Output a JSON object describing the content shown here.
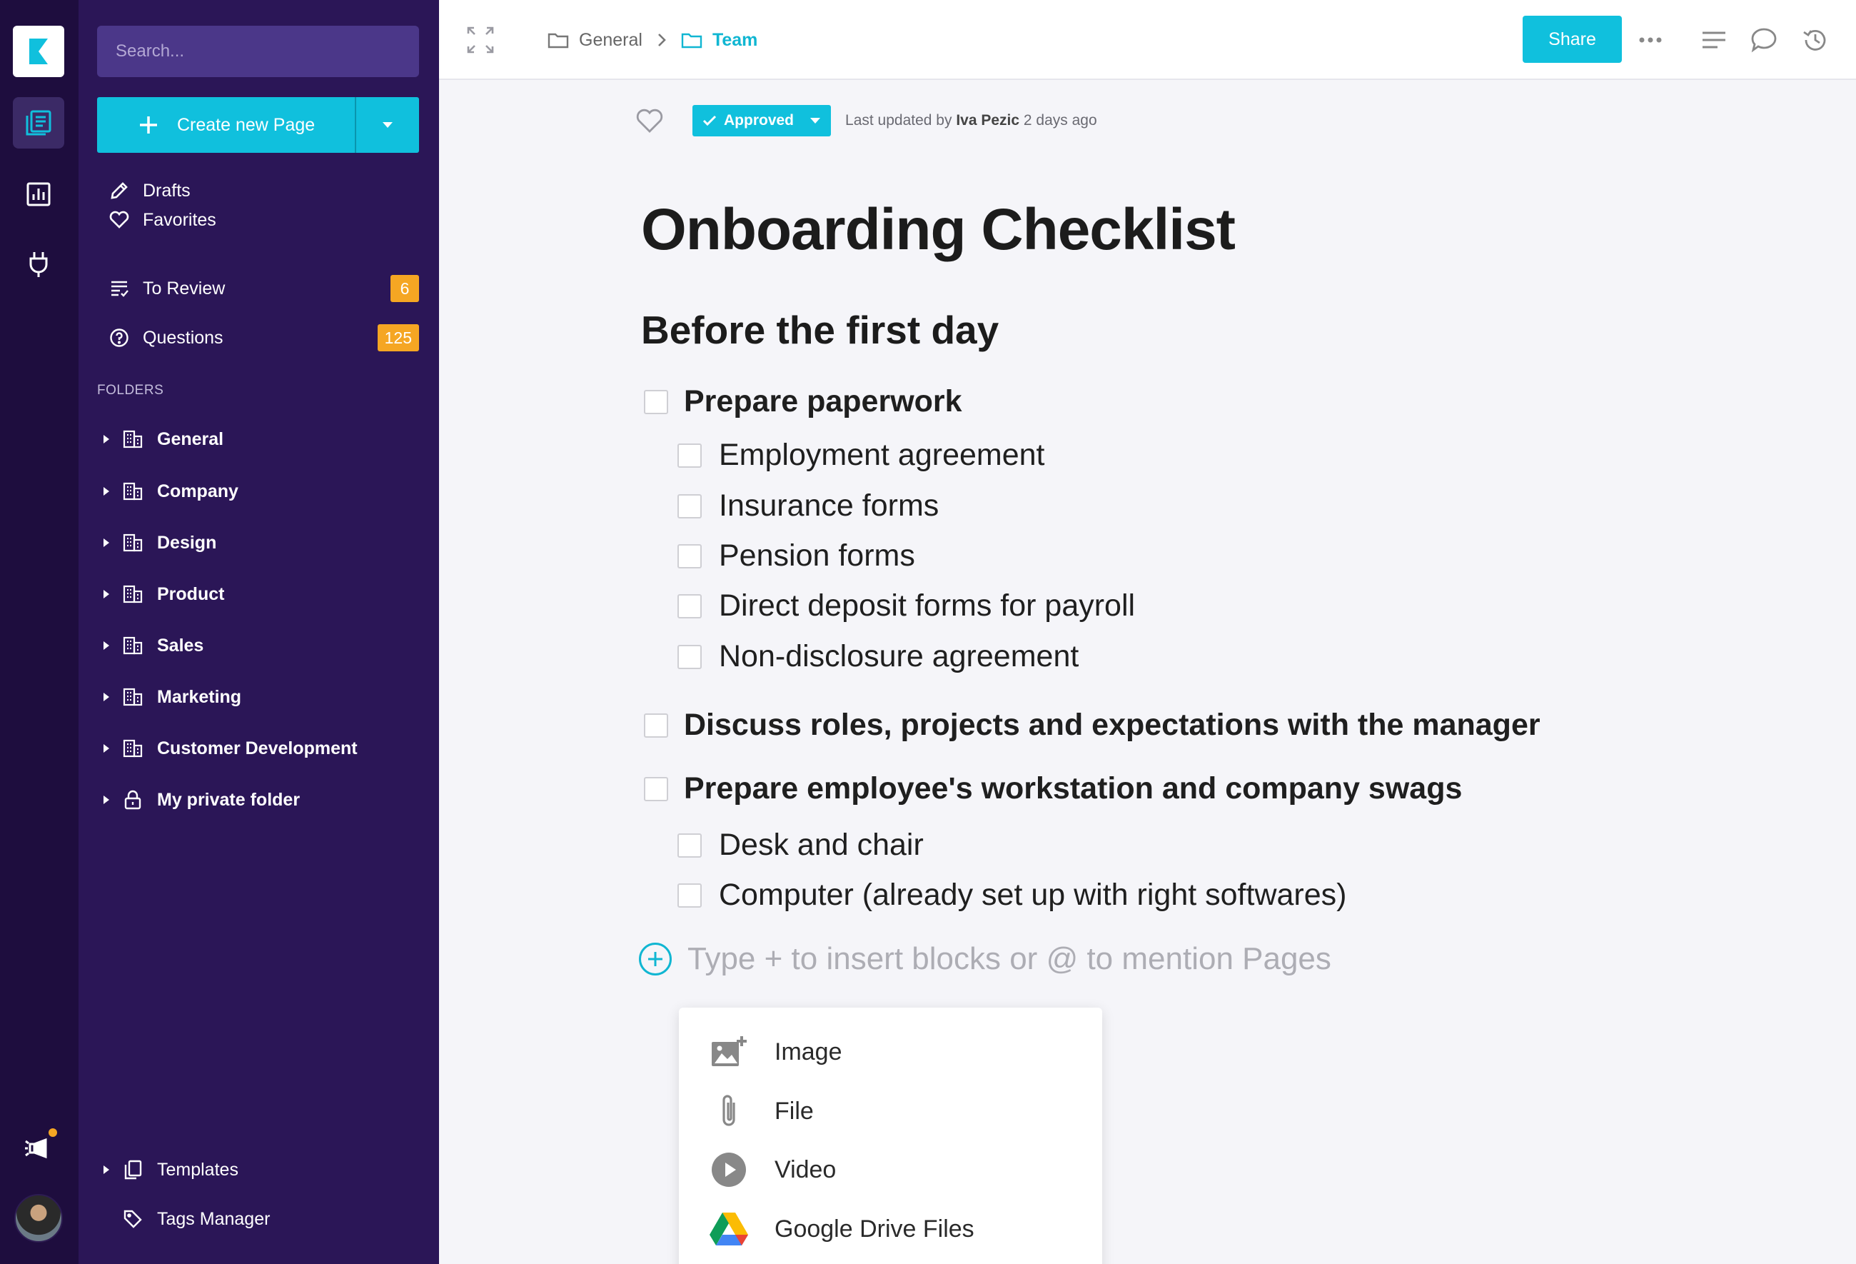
{
  "rail": {
    "icons": [
      "logo-icon",
      "pages-icon",
      "analytics-icon",
      "integrations-plug-icon",
      "announcements-icon"
    ],
    "colors": {
      "background": "#1e0d3e",
      "active": "#3b2a66",
      "notification": "#f5a623"
    }
  },
  "sidebar": {
    "search_placeholder": "Search...",
    "create_label": "Create new Page",
    "nav": [
      {
        "label": "Drafts",
        "icon": "pencil-icon"
      },
      {
        "label": "Favorites",
        "icon": "heart-icon"
      },
      {
        "label": "To Review",
        "icon": "review-list-icon",
        "badge": "6"
      },
      {
        "label": "Questions",
        "icon": "question-icon",
        "badge": "125"
      }
    ],
    "folders_heading": "FOLDERS",
    "folders": [
      {
        "label": "General",
        "icon": "building-icon"
      },
      {
        "label": "Company",
        "icon": "building-icon"
      },
      {
        "label": "Design",
        "icon": "building-icon"
      },
      {
        "label": "Product",
        "icon": "building-icon"
      },
      {
        "label": "Sales",
        "icon": "building-icon"
      },
      {
        "label": "Marketing",
        "icon": "building-icon"
      },
      {
        "label": "Customer Development",
        "icon": "building-icon"
      },
      {
        "label": "My private folder",
        "icon": "lock-icon"
      }
    ],
    "templates_label": "Templates",
    "tags_label": "Tags Manager",
    "colors": {
      "background": "#2b1657",
      "accent": "#10c0dd",
      "badge": "#f5a623"
    }
  },
  "topbar": {
    "breadcrumb": [
      "General",
      "Team"
    ],
    "share_label": "Share"
  },
  "document": {
    "status": "Approved",
    "updated_prefix": "Last updated by",
    "updated_by": "Iva Pezic",
    "updated_when": "2 days ago",
    "title": "Onboarding Checklist",
    "section": "Before the first day",
    "checklist": [
      {
        "text": "Prepare paperwork",
        "level": 1,
        "checked": false
      },
      {
        "text": "Employment agreement",
        "level": 2,
        "checked": false
      },
      {
        "text": "Insurance forms",
        "level": 2,
        "checked": false
      },
      {
        "text": "Pension forms",
        "level": 2,
        "checked": false
      },
      {
        "text": "Direct deposit forms for payroll",
        "level": 2,
        "checked": false
      },
      {
        "text": "Non-disclosure agreement",
        "level": 2,
        "checked": false
      },
      {
        "text": "Discuss roles, projects and expectations with the manager",
        "level": 1,
        "checked": false
      },
      {
        "text": "Prepare employee's workstation and company swags",
        "level": 1,
        "checked": false
      },
      {
        "text": "Desk and chair",
        "level": 2,
        "checked": false
      },
      {
        "text": "Computer (already set up with right softwares)",
        "level": 2,
        "checked": false
      }
    ],
    "insert_placeholder": "Type + to insert blocks or @ to mention Pages"
  },
  "insert_menu": [
    {
      "label": "Image",
      "icon": "image-add-icon"
    },
    {
      "label": "File",
      "icon": "paperclip-icon"
    },
    {
      "label": "Video",
      "icon": "play-icon"
    },
    {
      "label": "Google Drive Files",
      "icon": "google-drive-icon"
    }
  ]
}
